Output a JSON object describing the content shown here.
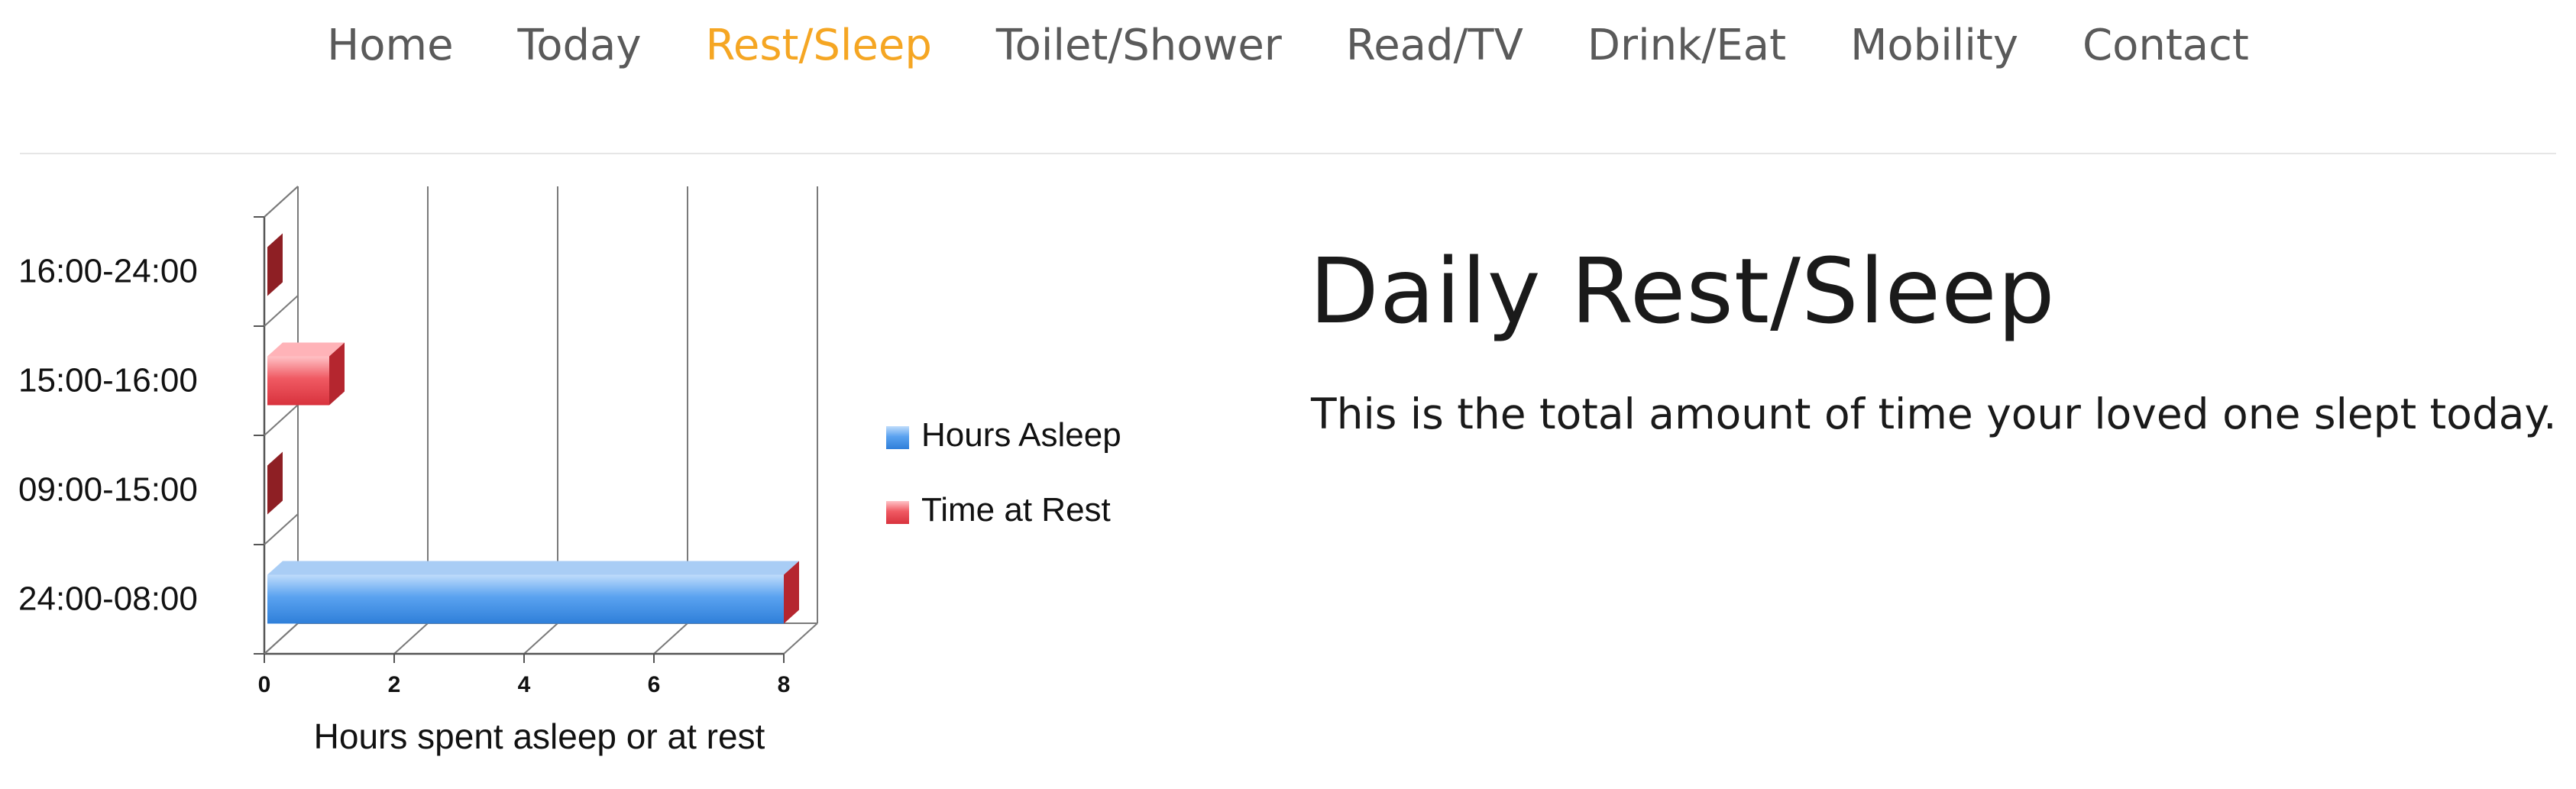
{
  "nav": {
    "items": [
      {
        "label": "Home",
        "active": false
      },
      {
        "label": "Today",
        "active": false
      },
      {
        "label": "Rest/Sleep",
        "active": true
      },
      {
        "label": "Toilet/Shower",
        "active": false
      },
      {
        "label": "Read/TV",
        "active": false
      },
      {
        "label": "Drink/Eat",
        "active": false
      },
      {
        "label": "Mobility",
        "active": false
      },
      {
        "label": "Contact",
        "active": false
      }
    ],
    "active_color": "#f5a623",
    "color": "#5a5a5a"
  },
  "main": {
    "title": "Daily Rest/Sleep",
    "description": "This is the total amount of time your loved one slept today."
  },
  "chart_data": {
    "type": "bar",
    "orientation": "horizontal",
    "style": "3d",
    "categories": [
      "24:00-08:00",
      "09:00-15:00",
      "15:00-16:00",
      "16:00-24:00"
    ],
    "series": [
      {
        "name": "Hours Asleep",
        "values": [
          8,
          0,
          0,
          0
        ],
        "color": "#4a90e2"
      },
      {
        "name": "Time at Rest",
        "values": [
          0,
          0,
          1,
          0
        ],
        "color": "#e8404a"
      }
    ],
    "xlabel": "Hours spent asleep or at rest",
    "ylabel": "",
    "xlim": [
      0,
      8
    ],
    "xticks": [
      "0",
      "2",
      "4",
      "6",
      "8"
    ],
    "grid": true,
    "legend": "right"
  }
}
